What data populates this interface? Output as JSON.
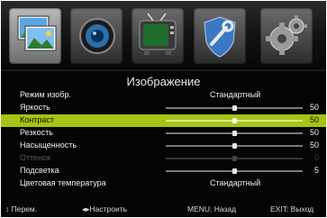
{
  "header": {
    "title": "Изображение"
  },
  "tabs": [
    {
      "name": "picture"
    },
    {
      "name": "sound"
    },
    {
      "name": "tv"
    },
    {
      "name": "settings"
    },
    {
      "name": "setup"
    }
  ],
  "rows": [
    {
      "label": "Режим изобр.",
      "value": "Стандартный"
    },
    {
      "label": "Яркость",
      "value": "50",
      "level": 0.5
    },
    {
      "label": "Контраст",
      "value": "50",
      "level": 0.5,
      "selected": true
    },
    {
      "label": "Резкость",
      "value": "50",
      "level": 0.5
    },
    {
      "label": "Насыщенность",
      "value": "50",
      "level": 0.5
    },
    {
      "label": "Оттенок",
      "value": "0",
      "level": 0.5,
      "disabled": true
    },
    {
      "label": "Подсветка",
      "value": "5",
      "level": 0.5
    },
    {
      "label": "Цветовая температура",
      "value": "Стандартный"
    }
  ],
  "footer": {
    "move": "Перем.",
    "adjust": "Настроить",
    "menu": "MENU: Назад",
    "exit": "EXIT: Выход"
  },
  "colors": {
    "selected_row": "#a6c414"
  }
}
